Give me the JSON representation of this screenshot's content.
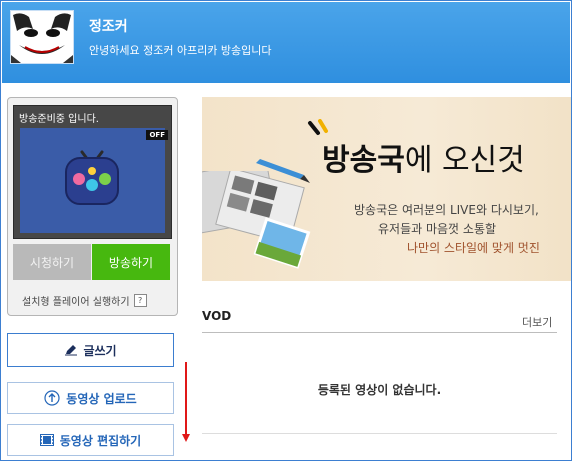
{
  "header": {
    "channel_name": "정조커",
    "channel_desc": "안녕하세요 정조커 아프리카 방송입니다"
  },
  "broadcast": {
    "status": "방송준비중 입니다.",
    "off_badge": "OFF",
    "watch_label": "시청하기",
    "broadcast_label": "방송하기",
    "installed_player_label": "설치형 플레이어 실행하기",
    "help_glyph": "?"
  },
  "actions": {
    "write_label": "글쓰기",
    "upload_label": "동영상 업로드",
    "edit_label": "동영상 편집하기"
  },
  "banner": {
    "title_bold": "방송국",
    "title_rest": "에 오신것",
    "line1": "방송국은 여러분의 LIVE와 다시보기,",
    "line2": "유저들과 마음껏 소통할",
    "line3": "나만의 스타일에 맞게 멋진 "
  },
  "vod": {
    "title": "VOD",
    "more_label": "더보기",
    "empty_message": "등록된 영상이 없습니다."
  },
  "colors": {
    "header_blue": "#3b97e3",
    "broadcast_green": "#47b80f",
    "annotation_red": "#e01818"
  }
}
